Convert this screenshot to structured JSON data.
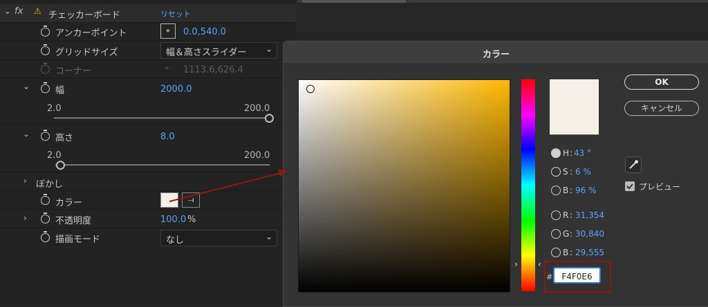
{
  "effect": {
    "name": "チェッカーボード",
    "reset": "リセット",
    "fx": "fx",
    "anchor": {
      "label": "アンカーポイント",
      "value": "0.0,540.0"
    },
    "grid_size": {
      "label": "グリッドサイズ",
      "value": "幅＆高さスライダー"
    },
    "corner": {
      "label": "コーナー",
      "value": "1113.6,626.4"
    },
    "width": {
      "label": "幅",
      "value": "2000.0",
      "min": "2.0",
      "max": "200.0",
      "slider_level": 1.0
    },
    "height": {
      "label": "高さ",
      "value": "8.0",
      "min": "2.0",
      "max": "200.0",
      "slider_level": 0.03
    },
    "blur": {
      "label": "ぼかし"
    },
    "color": {
      "label": "カラー",
      "swatch": "#f4f0e6"
    },
    "opacity": {
      "label": "不透明度",
      "value": "100.0",
      "unit": "%"
    },
    "blend_mode": {
      "label": "描画モード",
      "value": "なし"
    }
  },
  "dialog": {
    "title": "カラー",
    "ok": "OK",
    "cancel": "キャンセル",
    "preview_label": "プレビュー",
    "preview_checked": true,
    "selected_color": "#f4f0e6",
    "hsb": [
      {
        "key": "H",
        "sep": ":",
        "value": "43 °",
        "selected": true
      },
      {
        "key": "S",
        "sep": ":",
        "value": "6 %",
        "selected": false
      },
      {
        "key": "B",
        "sep": ":",
        "value": "96 %",
        "selected": false
      }
    ],
    "rgb": [
      {
        "key": "R",
        "sep": ":",
        "value": "31,354"
      },
      {
        "key": "G",
        "sep": ":",
        "value": "30,840"
      },
      {
        "key": "B",
        "sep": ":",
        "value": "29,555"
      }
    ],
    "hex_prefix": "#",
    "hex": "F4F0E6"
  },
  "colors": {
    "accent": "#5da3f0",
    "highlight_outline": "#8b1a12",
    "annotation_arrow": "#8b1a12"
  }
}
